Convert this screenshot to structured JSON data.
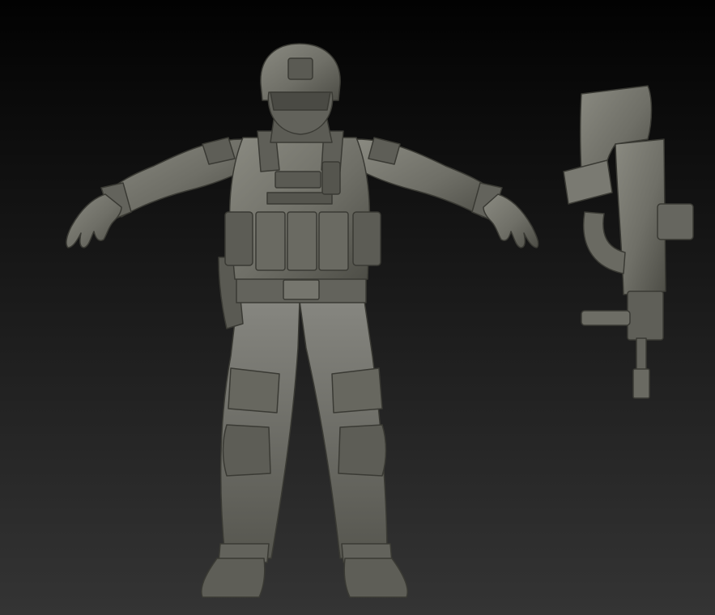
{
  "scene": {
    "background": {
      "top_color": "#020202",
      "bottom_color": "#343434"
    },
    "material": {
      "base": "#6f6f67",
      "light": "#8a8a81",
      "dark": "#3f3f39",
      "shadow": "#2b2b27"
    },
    "objects": [
      "soldier-sculpt",
      "rifle-sculpt"
    ]
  }
}
